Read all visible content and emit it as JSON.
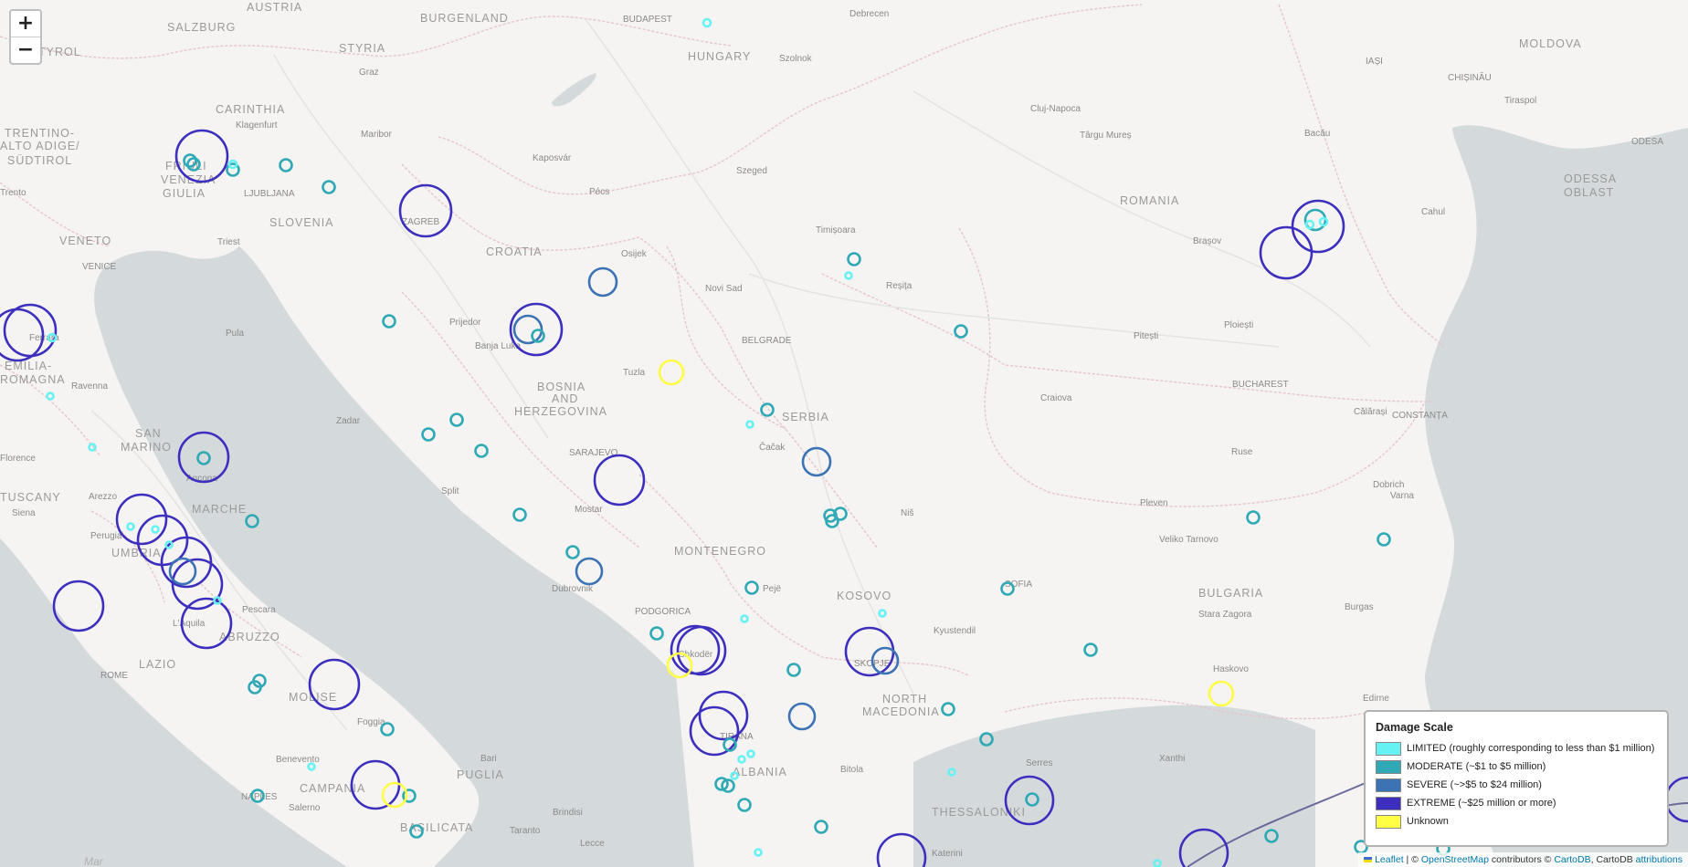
{
  "zoom": {
    "in_label": "+",
    "out_label": "−"
  },
  "legend": {
    "title": "Damage Scale",
    "items": [
      {
        "label": "LIMITED (roughly corresponding to less than $1 million)",
        "color": "#66f2f2"
      },
      {
        "label": "MODERATE (~$1 to $5 million)",
        "color": "#2fa9b5"
      },
      {
        "label": "SEVERE (~>$5 to $24 million)",
        "color": "#3c73b5"
      },
      {
        "label": "EXTREME (~$25 million or more)",
        "color": "#3d2fbe"
      },
      {
        "label": "Unknown",
        "color": "#ffff44"
      }
    ]
  },
  "attribution": {
    "leaflet": "Leaflet",
    "sep1": " | © ",
    "osm": "OpenStreetMap",
    "mid": " contributors © ",
    "cartodb": "CartoDB",
    "sep2": ", CartoDB ",
    "attributions": "attributions"
  },
  "map_labels": {
    "regions": [
      "AUSTRIA",
      "BURGENLAND",
      "SALZBURG",
      "STYRIA",
      "TYROL",
      "CARINTHIA",
      "TRENTINO-",
      "ALTO ADIGE/",
      "SÜDTIROL",
      "FRIULI",
      "VENEZIA",
      "GIULIA",
      "VENETO",
      "SLOVENIA",
      "CROATIA",
      "HUNGARY",
      "ROMANIA",
      "MOLDOVA",
      "ODESSA",
      "OBLAST",
      "EMILIA-",
      "ROMAGNA",
      "SAN",
      "MARINO",
      "TUSCANY",
      "MARCHE",
      "UMBRIA",
      "ABRUZZO",
      "LAZIO",
      "MOLISE",
      "CAMPANIA",
      "PUGLIA",
      "BASILICATA",
      "BOSNIA",
      "AND",
      "HERZEGOVINA",
      "SERBIA",
      "MONTENEGRO",
      "KOSOVO",
      "NORTH",
      "MACEDONIA",
      "ALBANIA",
      "BULGARIA",
      "THESSALONIKI"
    ],
    "cities": [
      "BUDAPEST",
      "Debrecen",
      "Szolnok",
      "Graz",
      "Klagenfurt",
      "Maribor",
      "LJUBLJANA",
      "Triest",
      "VENICE",
      "ZAGREB",
      "Kaposvár",
      "Pécs",
      "Szeged",
      "Osijek",
      "Novi Sad",
      "BELGRADE",
      "Timișoara",
      "Reșița",
      "Cluj-Napoca",
      "Târgu Mureș",
      "Brașov",
      "Bacău",
      "IAȘI",
      "CHIȘINĂU",
      "Tiraspol",
      "Cahul",
      "Ploiești",
      "Pitești",
      "BUCHAREST",
      "Craiova",
      "Călărași",
      "CONSTANȚA",
      "Ruse",
      "Dobrich",
      "Varna",
      "Pleven",
      "Veliko Tarnovo",
      "Stara Zagora",
      "Burgas",
      "Haskovo",
      "Edirne",
      "Xanthi",
      "Serres",
      "SOFIA",
      "Kyustendil",
      "Niš",
      "Čačak",
      "Tuzla",
      "Prijedor",
      "Banja Luka",
      "SARAJEVO",
      "Mostar",
      "Split",
      "Zadar",
      "Pula",
      "Dubrovnik",
      "PODGORICA",
      "Shkodër",
      "Pejë",
      "SKOPJE",
      "TIRANA",
      "Bitola",
      "Katerini",
      "Ferrara",
      "Ravenna",
      "Ancona",
      "Perugia",
      "Arezzo",
      "Siena",
      "L'Aquila",
      "Pescara",
      "ROME",
      "Foggia",
      "Benevento",
      "NAPLES",
      "Salerno",
      "Bari",
      "Brindisi",
      "Taranto",
      "Lecce",
      "ODESA",
      "Florence",
      "Trento"
    ],
    "sea": [
      "Mar"
    ]
  }
}
